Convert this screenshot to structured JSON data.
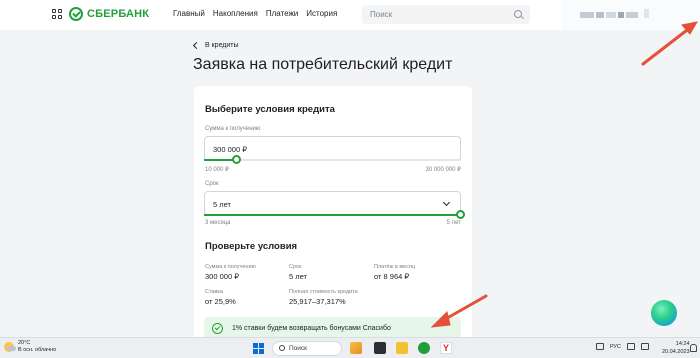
{
  "header": {
    "logo_text": "СБЕРБАНК",
    "nav": [
      "Главный",
      "Накопления",
      "Платежи",
      "История"
    ],
    "search_placeholder": "Поиск"
  },
  "breadcrumb": {
    "back_label": "В кредиты"
  },
  "page_title": "Заявка на потребительский кредит",
  "conditions": {
    "heading": "Выберите условия кредита",
    "amount": {
      "label": "Сумма к получению",
      "value": "300 000 ₽",
      "min_label": "10 000 ₽",
      "max_label": "30 000 000 ₽",
      "slider_fraction": 0.13
    },
    "term": {
      "label": "Срок",
      "value": "5 лет",
      "min_label": "3 месяца",
      "max_label": "5 лет",
      "slider_fraction": 1.0
    }
  },
  "review": {
    "heading": "Проверьте условия",
    "items": [
      {
        "label": "Сумма к получению",
        "value": "300 000 ₽"
      },
      {
        "label": "Срок",
        "value": "5 лет"
      },
      {
        "label": "Платёж в месяц",
        "value": "от 8 964 ₽"
      },
      {
        "label": "Ставка",
        "value": "от 25,9%"
      },
      {
        "label": "Полная стоимость кредита",
        "value": "25,917–37,317%"
      }
    ]
  },
  "promo": {
    "text": "1% ставки будем возвращать бонусами Спасибо"
  },
  "taskbar": {
    "weather_temp": "20°C",
    "weather_desc": "В осн. облачно",
    "search_placeholder": "Поиск",
    "lang": "РУС",
    "time": "14:24",
    "date": "20.04.2023"
  },
  "colors": {
    "brand": "#21a038",
    "annotation_arrow": "#e4503a"
  }
}
